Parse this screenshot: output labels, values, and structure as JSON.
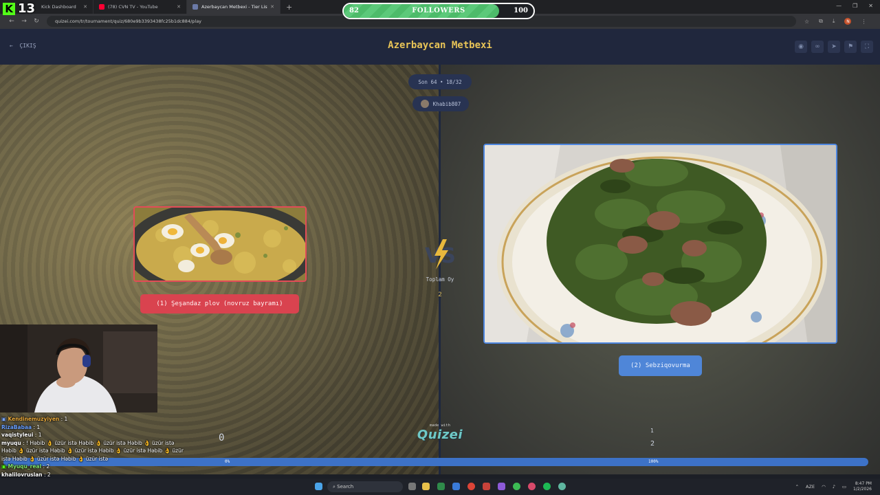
{
  "browser": {
    "tabs": [
      {
        "label": "Kick Dashboard",
        "color": "#53fc18"
      },
      {
        "label": "(78) CVN TV - YouTube",
        "color": "#ff0033"
      },
      {
        "label": "Azerbaycan Metbexi - Tier List",
        "color": "#6b7aa8"
      }
    ],
    "url": "quizei.com/tr/tournament/quiz/680e9b3393438fc25b1dc884/play",
    "profile_initial": "N"
  },
  "overlay": {
    "kick_count": "13",
    "followers_current": "82",
    "followers_label": "FOLLOWERS",
    "followers_goal": "100",
    "followers_progress": 0.82
  },
  "header": {
    "exit_label": "ÇIKIŞ",
    "title": "Azerbaycan Metbexi"
  },
  "match": {
    "round": "Son 64 • 18/32",
    "player": "Khabib807",
    "vs_label": "Toplam Oy",
    "vs_count": "2",
    "left_option": "(1) Şeşandaz plov (novruz bayramı)",
    "right_option": "(2) Sebziqovurma",
    "left_score": "0",
    "right_score_marker": "1",
    "right_score": "2",
    "progress_left": "0%",
    "progress_right": "100%",
    "made_with": "made with",
    "brand": "Quizei"
  },
  "chat": [
    {
      "user": "Kendinemuzyiyen",
      "color": "#e6a73a",
      "text": ": 1",
      "badge": true
    },
    {
      "user": "RizaBabaa",
      "color": "#6aa0ff",
      "text": ": 1"
    },
    {
      "user": "vaqistyleui",
      "color": "#ffffff",
      "text": ": 1"
    },
    {
      "user": "myuqu",
      "color": "#ffffff",
      "text": ": ! Həbib 👌 üzür istə Həbib 👌 üzür istə Həbib 👌 üzür istə Həbib 👌 üzür istə Həbib 👌 üzür istə Həbib 👌 üzür istə Həbib 👌 üzür istə Həbib 👌 üzür istə Həbib 👌 üzür istə"
    },
    {
      "user": "Myuqu_real",
      "color": "#7fe36b",
      "text": ": 2",
      "badge": true
    },
    {
      "user": "khalilovruslan",
      "color": "#ffffff",
      "text": ": 2"
    }
  ],
  "taskbar": {
    "search_label": "Search",
    "lang": "AZE",
    "time": "8:47 PM",
    "date": "1/2/2026"
  }
}
